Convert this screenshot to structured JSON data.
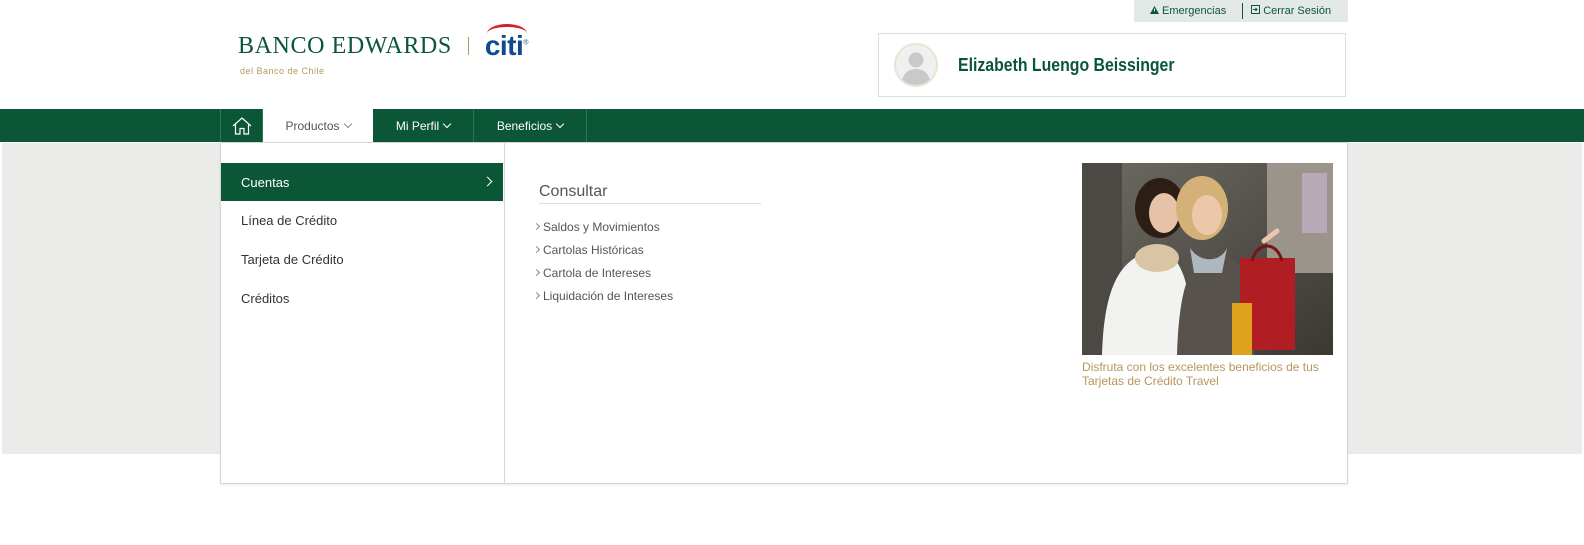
{
  "utility": {
    "emergencias": "Emergencias",
    "cerrar_sesion": "Cerrar Sesión"
  },
  "logo": {
    "brand": "BANCO EDWARDS",
    "partner": "citi",
    "subtitle": "del Banco de Chile"
  },
  "user": {
    "name": "Elizabeth Luengo Beissinger"
  },
  "nav": {
    "home_icon": "home-icon",
    "items": [
      {
        "label": "Productos",
        "active": true
      },
      {
        "label": "Mi Perfil",
        "active": false
      },
      {
        "label": "Beneficios",
        "active": false
      }
    ]
  },
  "menu": {
    "categories": [
      {
        "label": "Cuentas",
        "active": true
      },
      {
        "label": "Línea de Crédito",
        "active": false
      },
      {
        "label": "Tarjeta de Crédito",
        "active": false
      },
      {
        "label": "Créditos",
        "active": false
      }
    ],
    "section_title": "Consultar",
    "links": [
      "Saldos y Movimientos",
      "Cartolas Históricas",
      "Cartola de Intereses",
      "Liquidación de Intereses"
    ],
    "promo_caption": "Disfruta con los excelentes beneficios de tus Tarjetas de Crédito Travel"
  },
  "colors": {
    "brand_green": "#0a5637",
    "gold": "#b7965b",
    "citi_blue": "#0e4b8c",
    "citi_red": "#d2232a"
  }
}
